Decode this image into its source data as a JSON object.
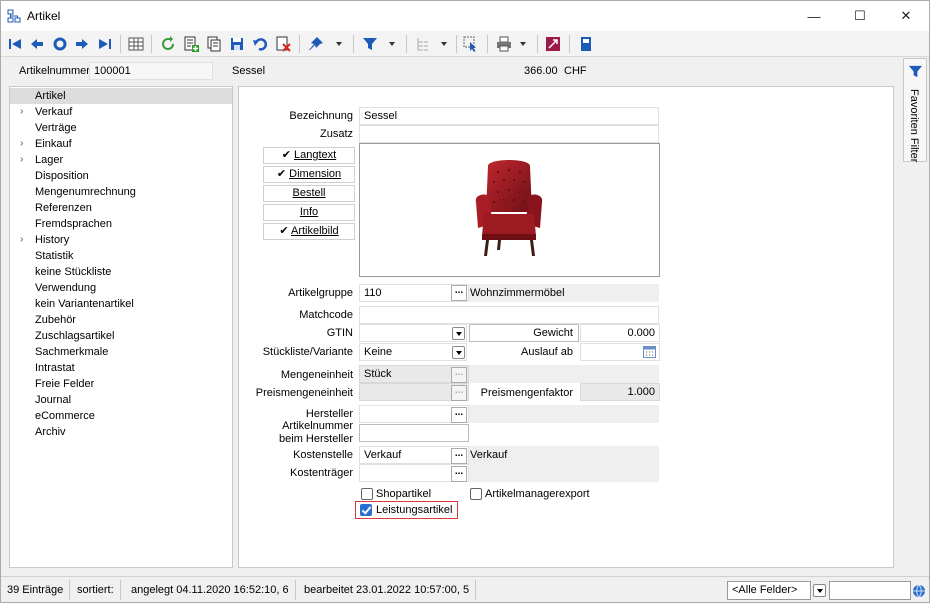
{
  "window": {
    "title": "Artikel",
    "minimize": "—",
    "maximize": "☐",
    "close": "✕"
  },
  "toolbar": {
    "icons": [
      "first-record-icon",
      "previous-record-icon",
      "refresh-icon",
      "next-record-icon",
      "last-record-icon",
      "table-view-icon",
      "reload-icon",
      "new-record-icon",
      "copy-record-icon",
      "save-icon",
      "undo-icon",
      "delete-icon",
      "pin-icon",
      "filter-icon",
      "tree-icon",
      "select-pointer-icon",
      "print-icon",
      "export-icon",
      "book-icon"
    ]
  },
  "header": {
    "artikelnummer_label": "Artikelnummer",
    "artikelnummer_value": "100001",
    "name": "Sessel",
    "price": "366.00",
    "currency": "CHF"
  },
  "nav": {
    "items": [
      {
        "label": "Artikel",
        "expandable": false,
        "selected": true
      },
      {
        "label": "Verkauf",
        "expandable": true
      },
      {
        "label": "Verträge",
        "expandable": false
      },
      {
        "label": "Einkauf",
        "expandable": true
      },
      {
        "label": "Lager",
        "expandable": true
      },
      {
        "label": "Disposition",
        "expandable": false
      },
      {
        "label": "Mengenumrechnung",
        "expandable": false
      },
      {
        "label": "Referenzen",
        "expandable": false
      },
      {
        "label": "Fremdsprachen",
        "expandable": false
      },
      {
        "label": "History",
        "expandable": true
      },
      {
        "label": "Statistik",
        "expandable": false
      },
      {
        "label": "keine Stückliste",
        "expandable": false
      },
      {
        "label": "Verwendung",
        "expandable": false
      },
      {
        "label": "kein Variantenartikel",
        "expandable": false
      },
      {
        "label": "Zubehör",
        "expandable": false
      },
      {
        "label": "Zuschlagsartikel",
        "expandable": false
      },
      {
        "label": "Sachmerkmale",
        "expandable": false
      },
      {
        "label": "Intrastat",
        "expandable": false
      },
      {
        "label": "Freie Felder",
        "expandable": false
      },
      {
        "label": "Journal",
        "expandable": false
      },
      {
        "label": "eCommerce",
        "expandable": false
      },
      {
        "label": "Archiv",
        "expandable": false
      }
    ]
  },
  "form": {
    "bezeichnung_label": "Bezeichnung",
    "bezeichnung_value": "Sessel",
    "zusatz_label": "Zusatz",
    "zusatz_value": "",
    "buttons": {
      "langtext": {
        "label": "Langtext",
        "checked": true
      },
      "dimension": {
        "label": "Dimension",
        "checked": true
      },
      "bestell": {
        "label": "Bestell",
        "checked": false
      },
      "info": {
        "label": "Info",
        "checked": false
      },
      "artikelbild": {
        "label": "Artikelbild",
        "checked": true
      }
    },
    "artikelgruppe_label": "Artikelgruppe",
    "artikelgruppe_value": "110",
    "artikelgruppe_desc": "Wohnzimmermöbel",
    "matchcode_label": "Matchcode",
    "matchcode_value": "",
    "gtin_label": "GTIN",
    "gtin_value": "",
    "gewicht_label": "Gewicht",
    "gewicht_value": "0.000",
    "stueckliste_label": "Stückliste/Variante",
    "stueckliste_value": "Keine",
    "auslauf_label": "Auslauf ab",
    "auslauf_value": "",
    "mengeneinheit_label": "Mengeneinheit",
    "mengeneinheit_value": "Stück",
    "preismengeneinheit_label": "Preismengeneinheit",
    "preismengeneinheit_value": "",
    "preismengenfaktor_label": "Preismengenfaktor",
    "preismengenfaktor_value": "1.000",
    "hersteller_label": "Hersteller",
    "hersteller_value": "",
    "herstellernr_label1": "Artikelnummer",
    "herstellernr_label2": "beim Hersteller",
    "herstellernr_value": "",
    "kostenstelle_label": "Kostenstelle",
    "kostenstelle_value": "Verkauf",
    "kostenstelle_desc": "Verkauf",
    "kostentraeger_label": "Kostenträger",
    "kostentraeger_value": "",
    "shopartikel_label": "Shopartikel",
    "shopartikel_checked": false,
    "artikelmanagerexport_label": "Artikelmanagerexport",
    "artikelmanagerexport_checked": false,
    "leistungsartikel_label": "Leistungsartikel",
    "leistungsartikel_checked": true,
    "ellipsis": "..."
  },
  "sidepanel": {
    "label": "Favoriten Filter"
  },
  "status": {
    "eintraege": "39 Einträge",
    "sortiert": "sortiert:",
    "angelegt": "angelegt 04.11.2020 16:52:10,  6",
    "bearbeitet": "bearbeitet 23.01.2022 10:57:00,  5",
    "felder_select": "<Alle Felder>",
    "search_value": ""
  },
  "colors": {
    "accent": "#1e5bb8",
    "chair_red": "#9c1a22",
    "highlight_border": "#d9363e"
  }
}
